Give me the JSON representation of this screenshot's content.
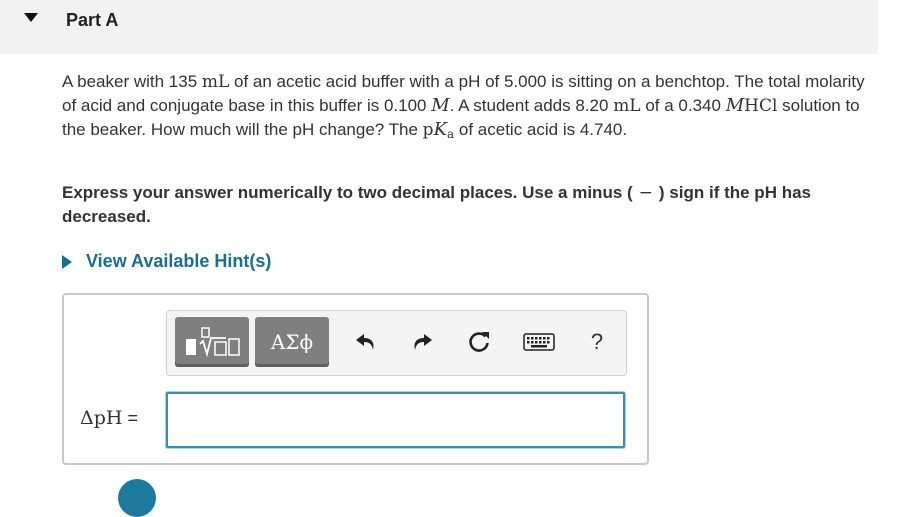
{
  "part": {
    "title": "Part A"
  },
  "question": {
    "t1": "A beaker with 135 ",
    "u_mL": "mL",
    "t2": " of an acetic acid buffer with a pH of 5.000 is sitting on a benchtop. The total molarity of acid and conjugate base in this buffer is 0.100 ",
    "u_M": "M",
    "t3": ".  A student adds 8.20 ",
    "u_mL2": "mL",
    "t4": " of a 0.340 ",
    "u_M2": "M",
    "chem": "HCl",
    "t5": " solution to the beaker. How much will the pH change? The ",
    "pk_p": "p",
    "pk_K": "K",
    "pk_sub": "a",
    "t6": " of acetic acid is 4.740."
  },
  "instruction": {
    "t1": "Express your answer numerically to two decimal places. Use a minus (",
    "minus": "−",
    "t2": ") sign if the pH has decreased."
  },
  "hints": {
    "label": "View Available Hint(s)"
  },
  "toolbar": {
    "symbols_label": "ΑΣϕ",
    "help_label": "?"
  },
  "answer": {
    "label_delta": "ΔpH",
    "label_eq": " =",
    "value": ""
  },
  "colors": {
    "link": "#1a6e8e",
    "input_border": "#3a8fad",
    "toolbar_button": "#7f7f7f"
  },
  "icons": [
    "collapse-caret-icon",
    "expand-caret-icon",
    "templates-icon",
    "undo-icon",
    "redo-icon",
    "reset-icon",
    "keyboard-icon",
    "help-icon"
  ]
}
